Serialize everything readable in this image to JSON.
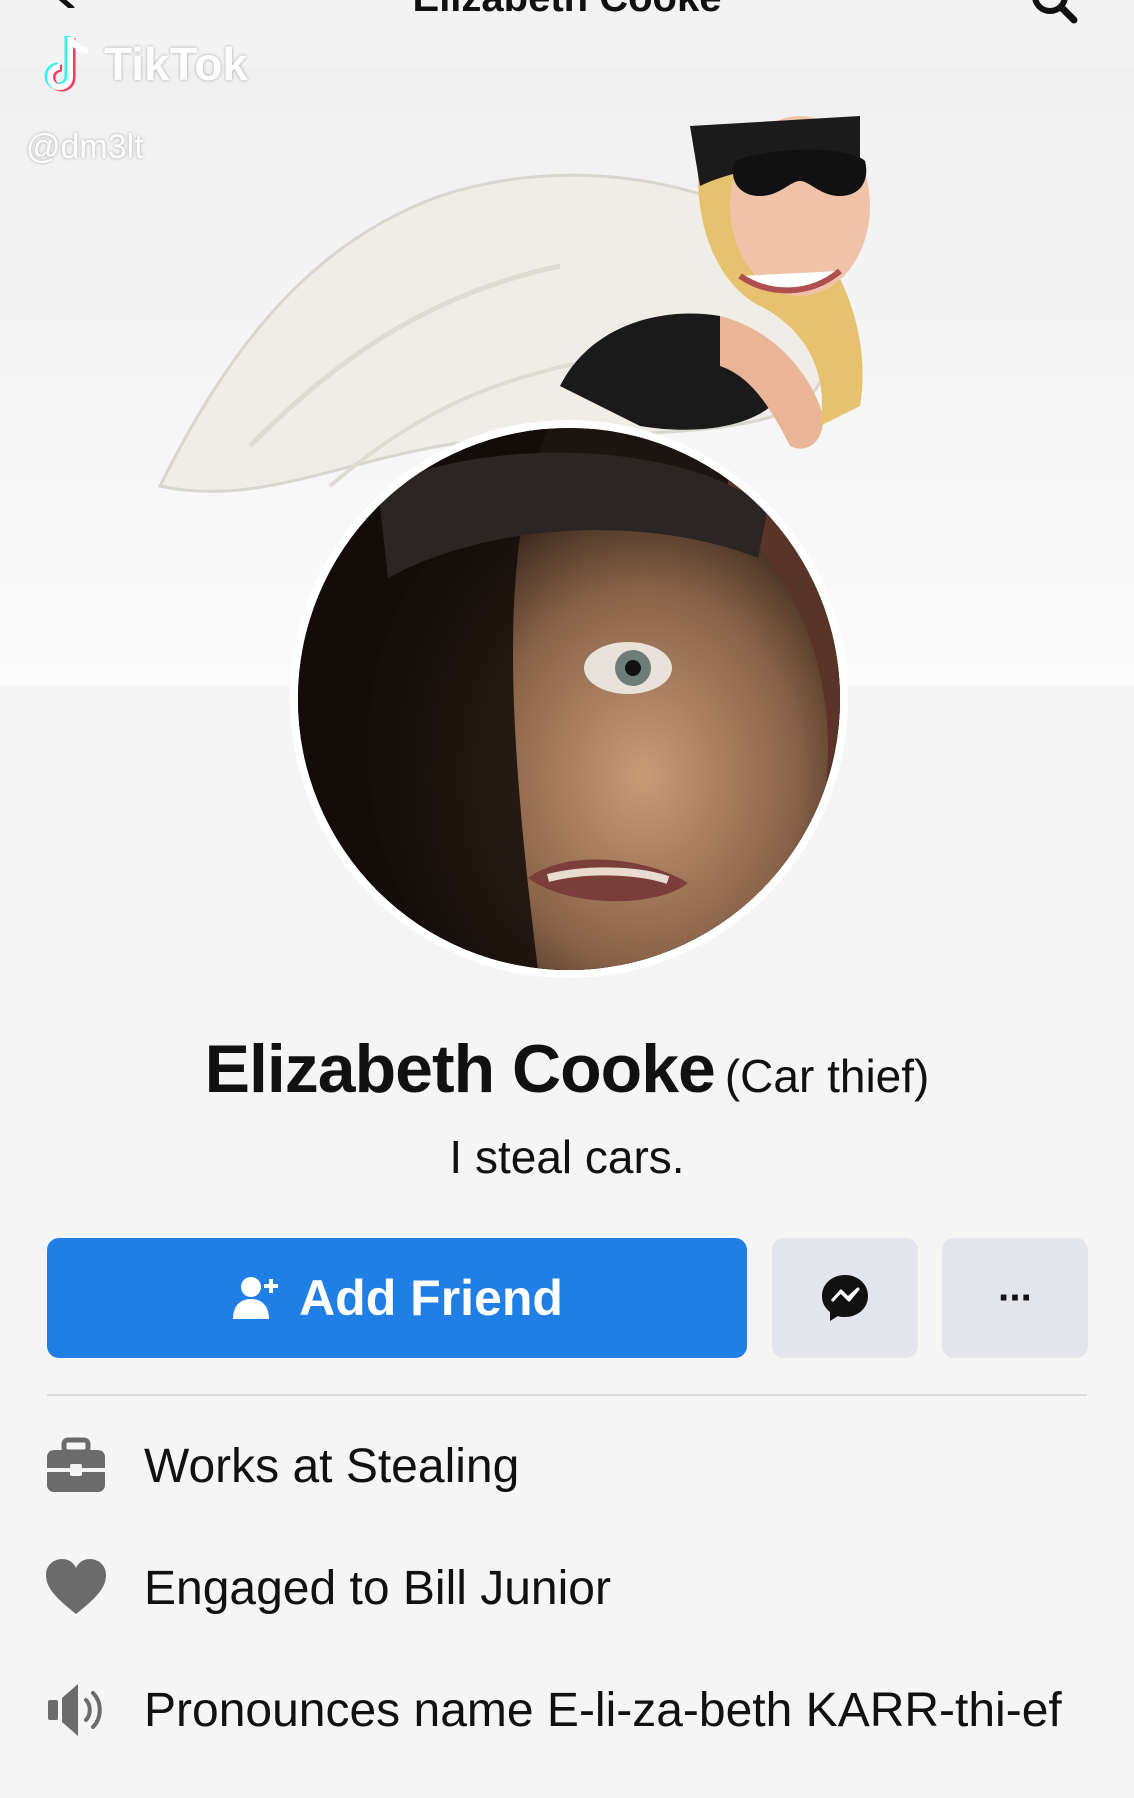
{
  "header": {
    "title": "Elizabeth Cooke"
  },
  "watermark": {
    "brand": "TikTok",
    "handle": "@dm3lt"
  },
  "profile": {
    "name": "Elizabeth Cooke",
    "nickname": "(Car thief)",
    "bio": "I steal cars."
  },
  "actions": {
    "add_friend_label": "Add Friend",
    "more_label": "···"
  },
  "info": [
    {
      "prefix": "Works at ",
      "highlight": "Stealing",
      "icon": "briefcase-icon"
    },
    {
      "prefix": "Engaged to ",
      "highlight": "Bill Junior",
      "icon": "heart-icon"
    },
    {
      "prefix": "Pronounces name ",
      "highlight": "E-li-za-beth KARR-thi-ef",
      "icon": "speaker-icon"
    }
  ],
  "colors": {
    "accent": "#1f7fe5",
    "icon_grey": "#6b6b6b",
    "button_grey": "#e4e5ea"
  }
}
